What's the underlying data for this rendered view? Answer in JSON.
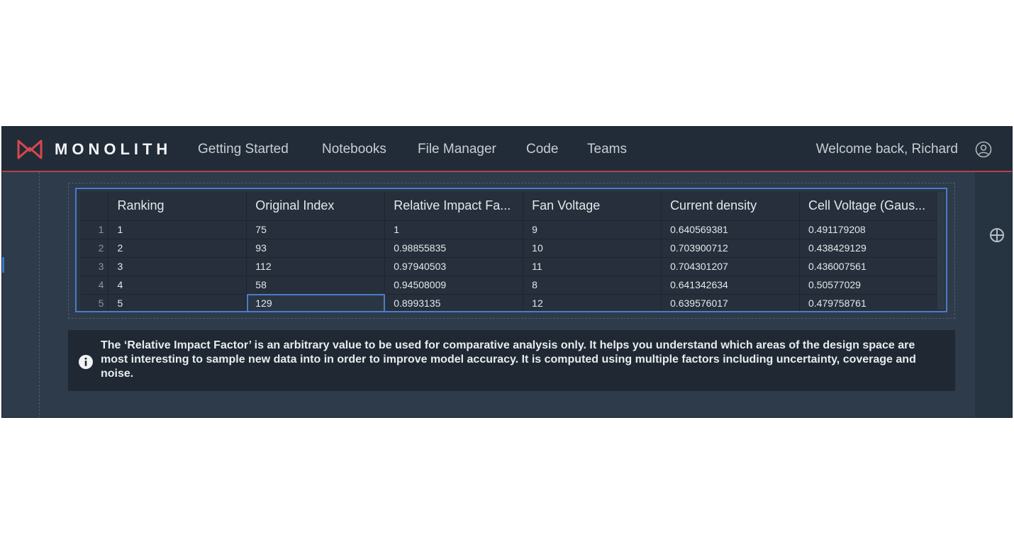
{
  "topbar": {
    "brand": "MONOLITH",
    "nav": [
      "Getting Started",
      "Notebooks",
      "File Manager",
      "Code",
      "Teams"
    ],
    "welcome": "Welcome back, Richard"
  },
  "table": {
    "columns": [
      "Ranking",
      "Original Index",
      "Relative Impact Fa...",
      "Fan Voltage",
      "Current density",
      "Cell Voltage (Gaus..."
    ],
    "rows": [
      {
        "n": "1",
        "cells": [
          "1",
          "75",
          "1",
          "9",
          "0.640569381",
          "0.491179208"
        ]
      },
      {
        "n": "2",
        "cells": [
          "2",
          "93",
          "0.98855835",
          "10",
          "0.703900712",
          "0.438429129"
        ]
      },
      {
        "n": "3",
        "cells": [
          "3",
          "112",
          "0.97940503",
          "11",
          "0.704301207",
          "0.436007561"
        ]
      },
      {
        "n": "4",
        "cells": [
          "4",
          "58",
          "0.94508009",
          "8",
          "0.641342634",
          "0.50577029"
        ]
      },
      {
        "n": "5",
        "cells": [
          "5",
          "129",
          "0.8993135",
          "12",
          "0.639576017",
          "0.479758761"
        ]
      }
    ],
    "selected_cell": {
      "row": 5,
      "column": "Original Index"
    }
  },
  "info": {
    "text": "The ‘Relative Impact Factor’ is an arbitrary value to be used for comparative analysis only. It helps you understand which areas of the design space are most interesting to sample new data into in order to improve model accuracy. It is computed using multiple factors including uncertainty, coverage and noise."
  },
  "colors": {
    "accent": "#b4424c",
    "selection": "#4a7cc9",
    "topbar": "#222c38",
    "panel": "#2d3b4b"
  }
}
